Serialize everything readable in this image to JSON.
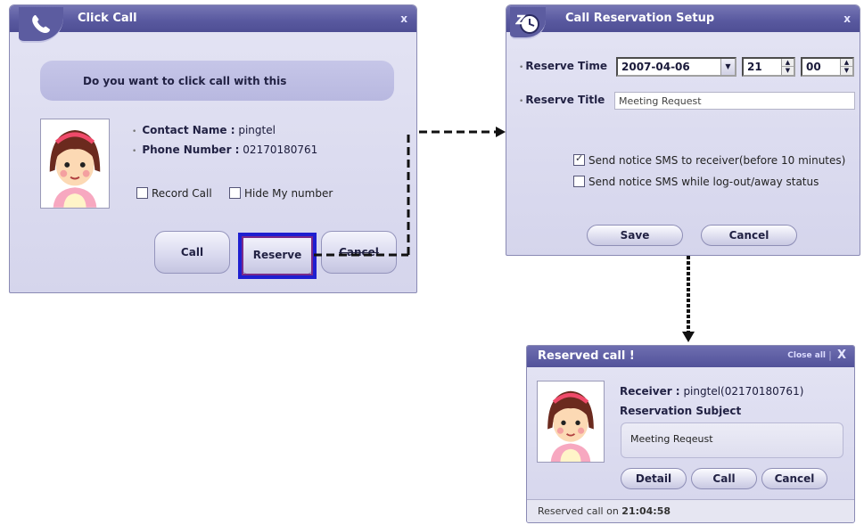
{
  "click_call": {
    "title": "Click Call",
    "close": "x",
    "question": "Do you want to click call with this",
    "contact_label": "Contact Name :",
    "contact_value": "pingtel",
    "phone_label": "Phone Number :",
    "phone_value": "02170180761",
    "record_call": {
      "label": "Record Call",
      "checked": false
    },
    "hide_number": {
      "label": "Hide My number",
      "checked": false
    },
    "buttons": {
      "call": "Call",
      "reserve": "Reserve",
      "cancel": "Cancel"
    },
    "highlight_color": "#1f1fd0"
  },
  "reservation_setup": {
    "title": "Call Reservation Setup",
    "close": "x",
    "reserve_time_label": "Reserve Time",
    "date_value": "2007-04-06",
    "hour_value": "21",
    "minute_value": "00",
    "reserve_title_label": "Reserve Title",
    "title_value": "Meeting Request",
    "sms_before": {
      "label": "Send notice SMS to receiver(before 10 minutes)",
      "checked": true
    },
    "sms_away": {
      "label": "Send notice SMS while log-out/away status",
      "checked": false
    },
    "buttons": {
      "save": "Save",
      "cancel": "Cancel"
    }
  },
  "reserved_call": {
    "title": "Reserved call  !",
    "close_all": "Close all",
    "close": "X",
    "receiver_label": "Receiver :",
    "receiver_value": "pingtel(02170180761)",
    "subject_label": "Reservation Subject",
    "subject_value": "Meeting Reqeust",
    "buttons": {
      "detail": "Detail",
      "call": "Call",
      "cancel": "Cancel"
    },
    "footer_prefix": "Reserved call on",
    "footer_time": "21:04:58"
  },
  "colors": {
    "title_bar": "#5a5aa0",
    "window_bg": "#dcdcf0",
    "accent_highlight": "#1f1fd0"
  }
}
